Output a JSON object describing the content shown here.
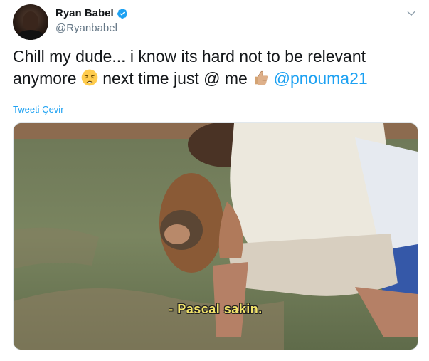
{
  "user": {
    "display_name": "Ryan Babel",
    "handle": "@Ryanbabel",
    "verified": true,
    "avatar": "profile-photo"
  },
  "tweet": {
    "text_part1": "Chill my dude... i know its hard not to be relevant anymore ",
    "emoji1": "weary-face-emoji",
    "text_part2": "  next time just @ me ",
    "emoji2": "thumbs-up-emoji",
    "mention": "@pnouma21"
  },
  "translate_label": "Tweeti Çevir",
  "media": {
    "caption": "- Pascal sakin."
  },
  "colors": {
    "link": "#1da1f2",
    "text": "#14171a",
    "muted": "#657786",
    "caption": "#f2e36a"
  }
}
